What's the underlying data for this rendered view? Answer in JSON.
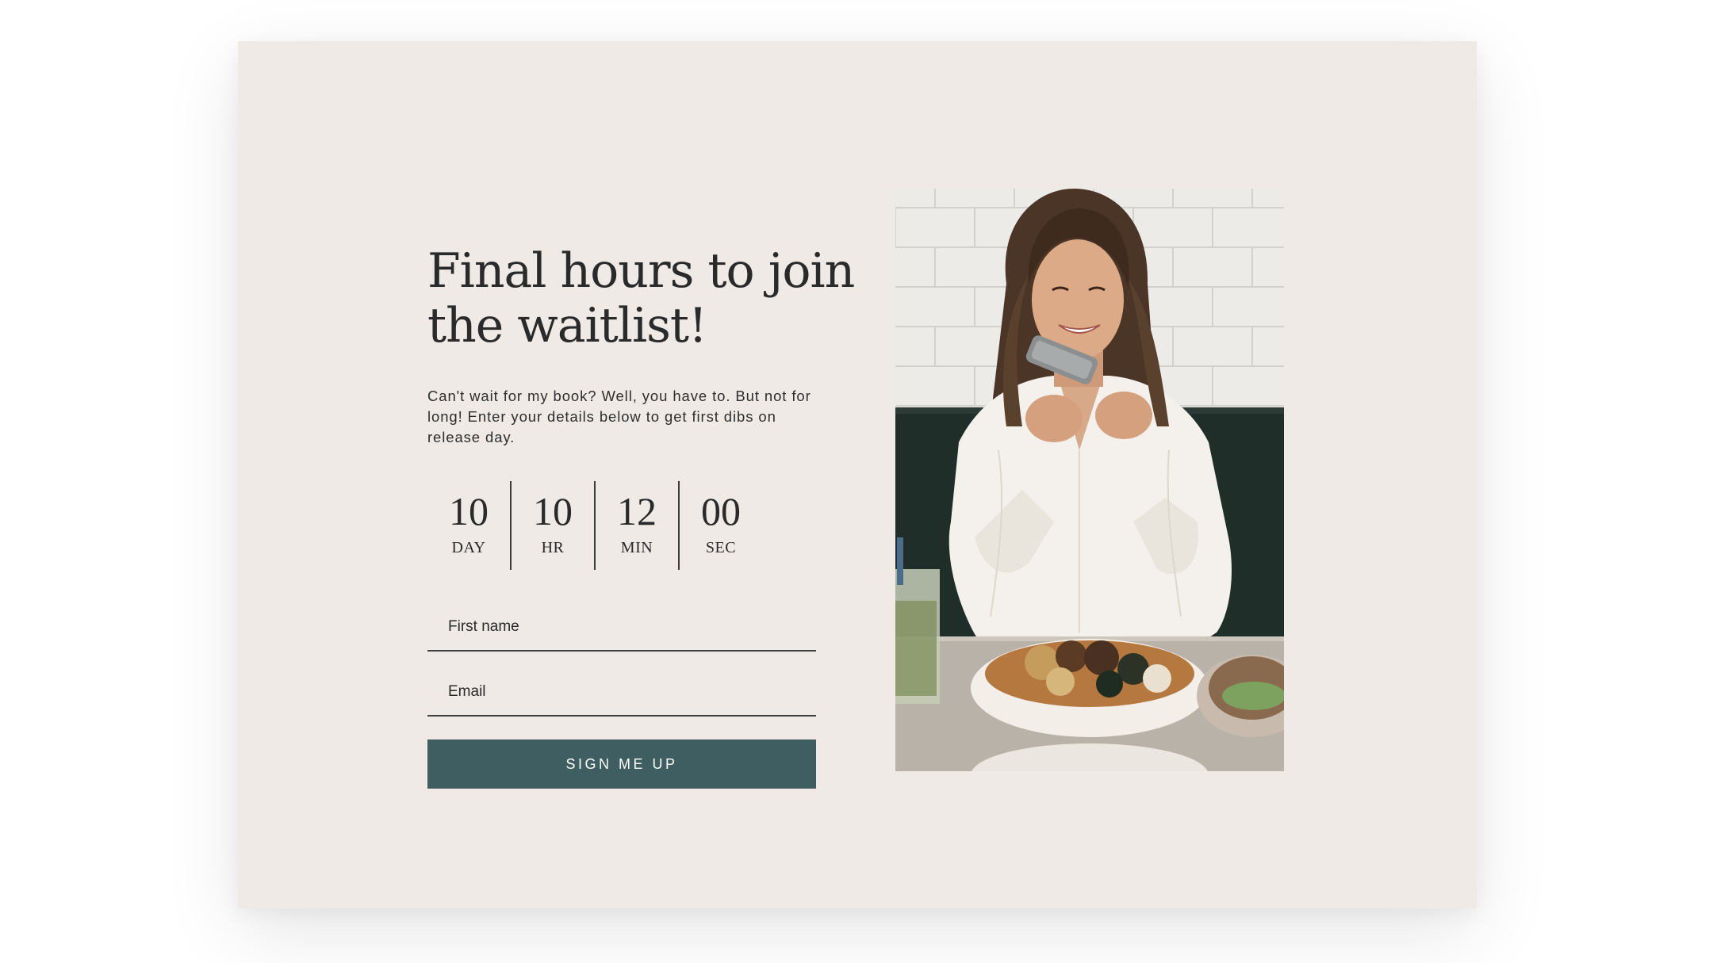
{
  "headline": "Final hours to join the waitlist!",
  "body": "Can't wait for my book? Well, you have to. But not for long! Enter your details below to get first dibs on release day.",
  "countdown": [
    {
      "value": "10",
      "label": "DAY"
    },
    {
      "value": "10",
      "label": "HR"
    },
    {
      "value": "12",
      "label": "MIN"
    },
    {
      "value": "00",
      "label": "SEC"
    }
  ],
  "form": {
    "first_name_placeholder": "First name",
    "email_placeholder": "Email",
    "submit_label": "SIGN ME UP"
  },
  "colors": {
    "card_background": "#efeae6",
    "button": "#3f5e61",
    "text": "#2a2a2a"
  },
  "image": {
    "subject": "woman-photographing-food-with-phone"
  }
}
